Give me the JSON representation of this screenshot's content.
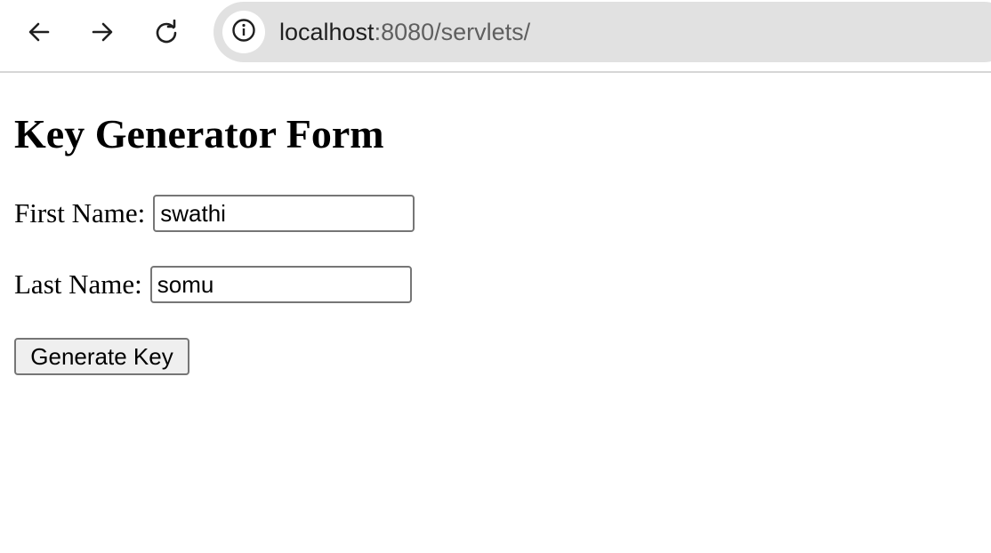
{
  "browser": {
    "icons": {
      "back": "arrow-left-icon",
      "forward": "arrow-right-icon",
      "reload": "reload-icon",
      "site_info": "info-icon"
    },
    "address_bar": {
      "host": "localhost",
      "rest": ":8080/servlets/"
    }
  },
  "page": {
    "title": "Key Generator Form",
    "form": {
      "first_name_label": "First Name:",
      "first_name_value": "swathi",
      "last_name_label": "Last Name:",
      "last_name_value": "somu",
      "submit_label": "Generate Key"
    }
  }
}
